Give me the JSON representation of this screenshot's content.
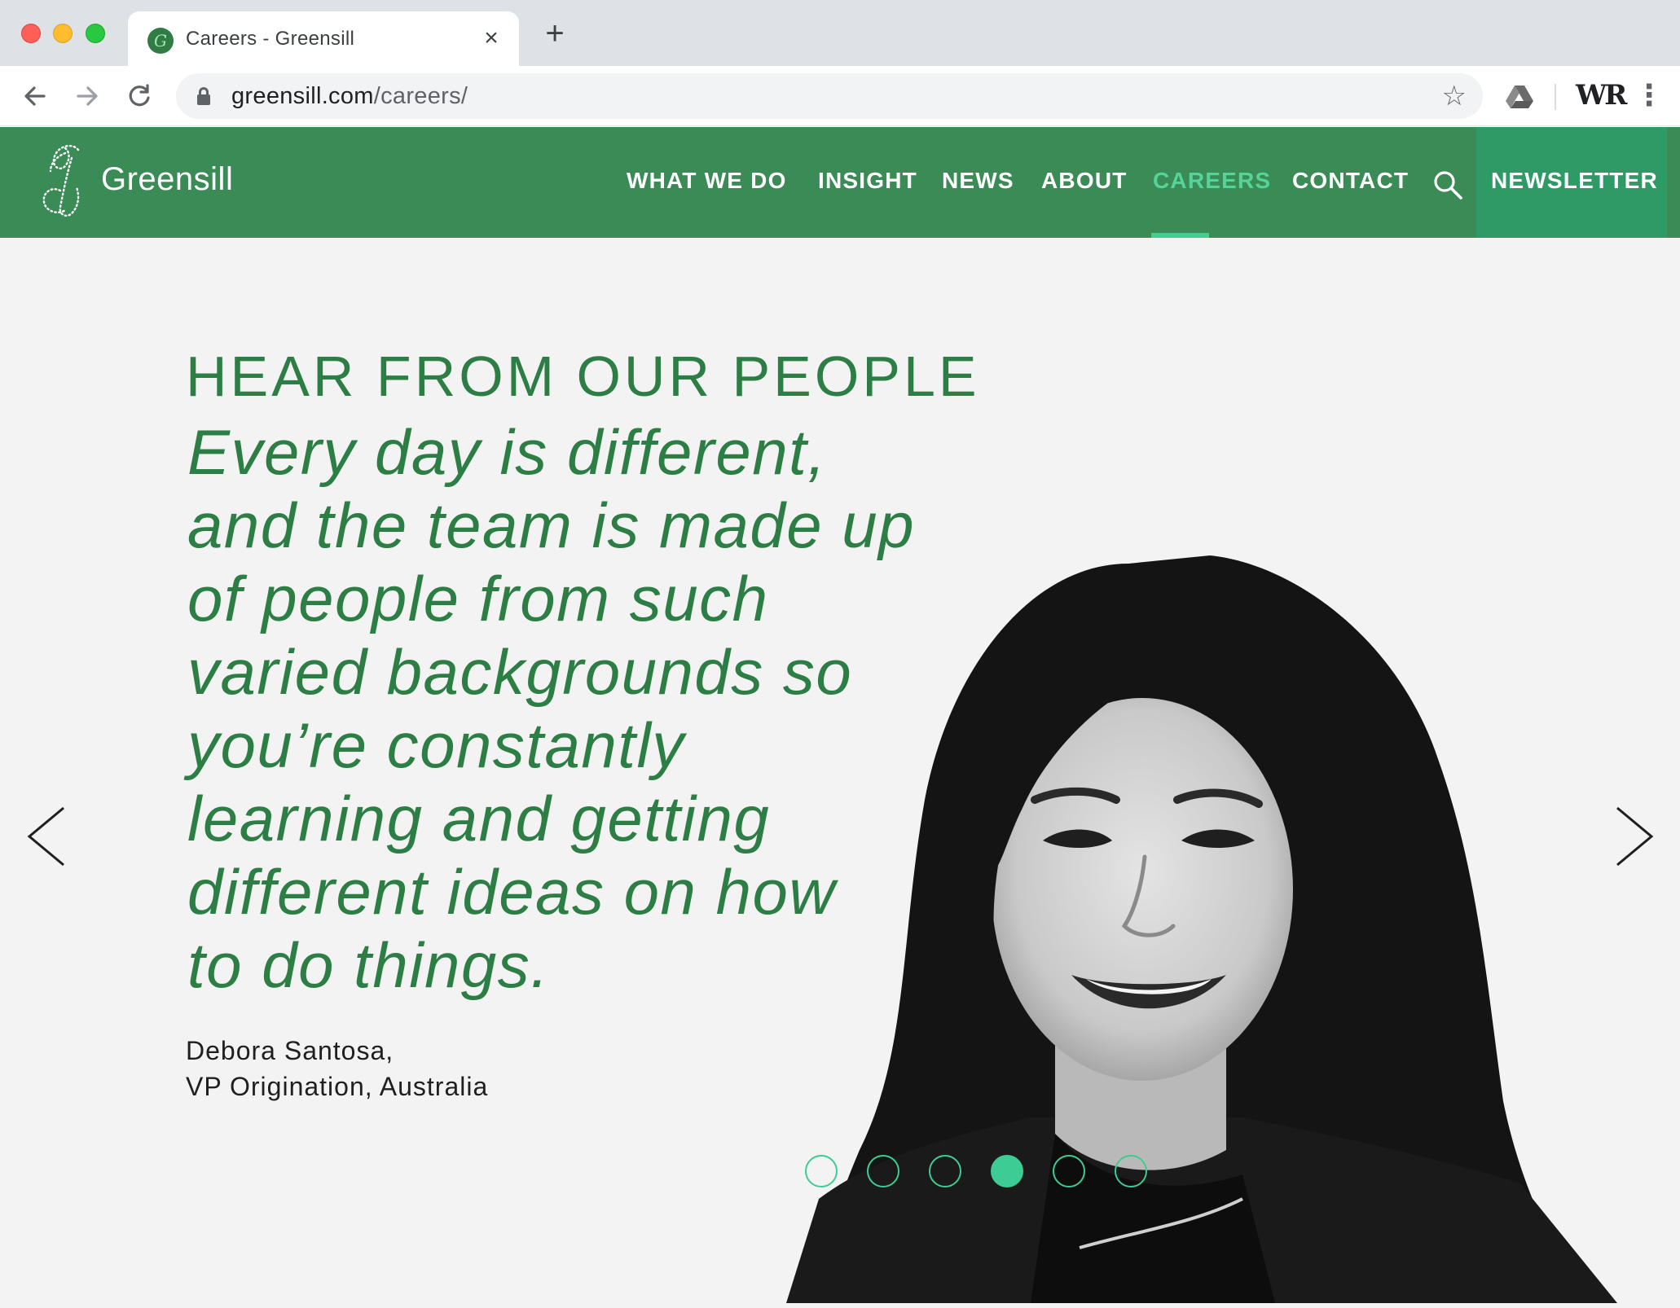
{
  "browser": {
    "tab_title": "Careers - Greensill",
    "tab_close": "×",
    "new_tab": "+",
    "url_domain": "greensill.com",
    "url_path": "/careers/",
    "extension_label": "WR"
  },
  "site": {
    "logo_text": "Greensill",
    "logo_initial": "G",
    "nav": [
      {
        "label": "WHAT WE DO",
        "active": false
      },
      {
        "label": "INSIGHT",
        "active": false
      },
      {
        "label": "NEWS",
        "active": false
      },
      {
        "label": "ABOUT",
        "active": false
      },
      {
        "label": "CAREERS",
        "active": true
      },
      {
        "label": "CONTACT",
        "active": false
      }
    ],
    "newsletter_label": "NEWSLETTER",
    "colors": {
      "header_bg": "#3a8b55",
      "newsletter_bg": "#2e9a66",
      "active_nav": "#56d39a",
      "accent": "#3dcc94",
      "heading_text": "#2c7e45"
    }
  },
  "hero": {
    "heading": "HEAR FROM OUR PEOPLE",
    "quote_lines": [
      "Every day is different,",
      "and the team is made up",
      "of people from such",
      "varied backgrounds so",
      "you’re constantly",
      "learning and getting",
      "different ideas on how",
      "to do things."
    ],
    "person_name": "Debora Santosa,",
    "person_role": "VP Origination, Australia",
    "carousel": {
      "total_slides": 6,
      "active_index": 3
    }
  }
}
